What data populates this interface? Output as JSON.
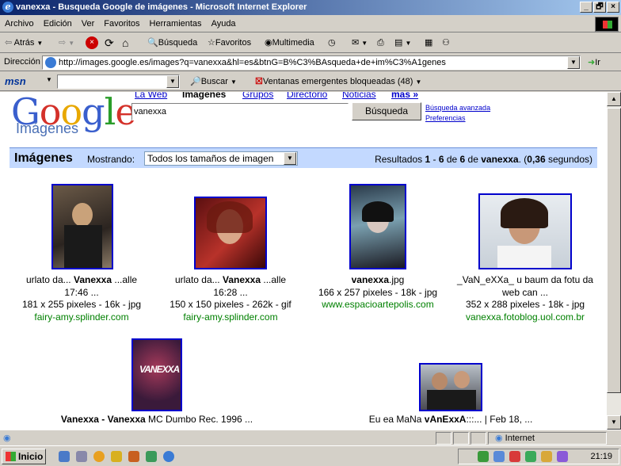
{
  "window": {
    "title": "vanexxa - Busqueda Google de imágenes - Microsoft Internet Explorer",
    "controls": [
      "_",
      "🗗",
      "×"
    ]
  },
  "menu": [
    "Archivo",
    "Edición",
    "Ver",
    "Favoritos",
    "Herramientas",
    "Ayuda"
  ],
  "toolbar": {
    "back": "Atrás",
    "search": "Búsqueda",
    "favorites": "Favoritos",
    "multimedia": "Multimedia"
  },
  "address": {
    "label": "Dirección",
    "url": "http://images.google.es/images?q=vanexxa&hl=es&btnG=B%C3%BAsqueda+de+im%C3%A1genes",
    "go": "Ir"
  },
  "msn": {
    "logo": "msn",
    "search": "Buscar",
    "popups": "Ventanas emergentes bloqueadas (48)"
  },
  "google": {
    "logo": "Google",
    "logo_sub": "Imágenes",
    "nav": [
      "La Web",
      "Imágenes",
      "Grupos",
      "Directorio",
      "Noticias",
      "más »"
    ],
    "query": "vanexxa",
    "search_button": "Búsqueda",
    "advanced": "Búsqueda avanzada",
    "prefs": "Preferencias",
    "colors": {
      "blue": "#0000cc",
      "green": "#008000",
      "bar": "#c3d9ff"
    }
  },
  "results_bar": {
    "title": "Imágenes",
    "showing": "Mostrando:",
    "size_select": "Todos los tamaños de imagen",
    "stats_prefix": "Resultados ",
    "range_start": "1",
    "dash": " - ",
    "range_end": "6",
    "of": " de ",
    "total": "6",
    "of2": " de ",
    "query": "vanexxa",
    "dot": ". (",
    "time": "0,36",
    "seconds": " segundos)"
  },
  "results": [
    {
      "pre": "urlato da... ",
      "bold": "Vanexxa",
      "post": " ...alle",
      "line2": "17:46 ...",
      "dims": "181 x 255 pixeles - 16k - jpg",
      "site": "fairy-amy.splinder.com"
    },
    {
      "pre": "urlato da... ",
      "bold": "Vanexxa",
      "post": " ...alle",
      "line2": "16:28 ...",
      "dims": "150 x 150 pixeles - 262k - gif",
      "site": "fairy-amy.splinder.com"
    },
    {
      "pre": "",
      "bold": "vanexxa",
      "post": ".jpg",
      "line2": "",
      "dims": "166 x 257 pixeles - 18k - jpg",
      "site": "www.espacioartepolis.com"
    },
    {
      "pre": "_VaN_eXXa_ u baum da fotu da",
      "bold": "",
      "post": "",
      "line2": "web can ...",
      "dims": "352 x 288 pixeles - 18k - jpg",
      "site": "vanexxa.fotoblog.uol.com.br"
    },
    {
      "pre": "",
      "bold": "Vanexxa - Vanexxa",
      "post": " MC Dumbo Rec. 1996 ...",
      "line2": "",
      "dims": "",
      "site": ""
    },
    {
      "pre": "Eu ea MaNa ",
      "bold": "vAnExxA",
      "post": ":::... | Feb 18, ...",
      "line2": "",
      "dims": "",
      "site": ""
    }
  ],
  "status": {
    "zone": "Internet"
  },
  "taskbar": {
    "start": "Inicio",
    "clock": "21:19"
  }
}
